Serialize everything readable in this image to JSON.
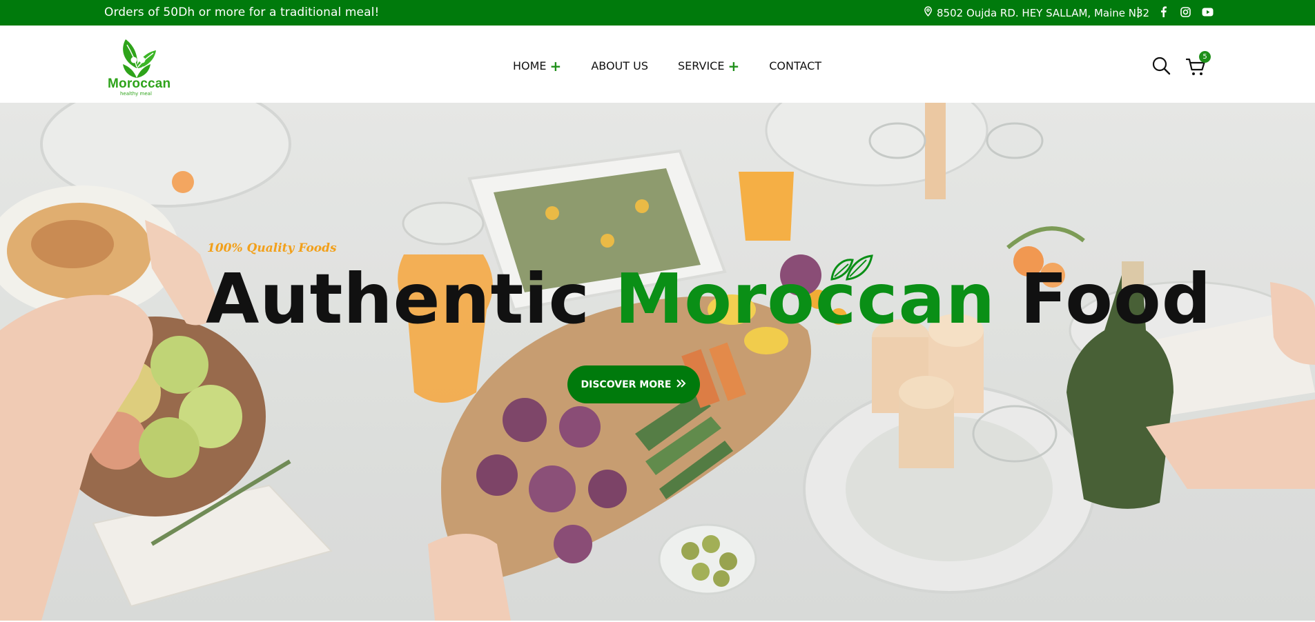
{
  "topbar": {
    "promo": "Orders of 50Dh or more for a traditional meal!",
    "address": "8502 Oujda RD. HEY SALLAM, Maine N32",
    "separator": "|",
    "social_icons": [
      "facebook-icon",
      "instagram-icon",
      "youtube-icon"
    ]
  },
  "header": {
    "logo": {
      "word": "Moroccan",
      "subtitle": "healthy meal"
    },
    "nav": [
      {
        "label": "HOME",
        "has_submenu": true
      },
      {
        "label": "ABOUT US",
        "has_submenu": false
      },
      {
        "label": "SERVICE",
        "has_submenu": true
      },
      {
        "label": "CONTACT",
        "has_submenu": false
      }
    ],
    "nav_plus": "+",
    "cart_count": "5"
  },
  "hero": {
    "tagline": "100% Quality Foods",
    "headline_part1": "Authentic ",
    "headline_part2": "Moroccan",
    "headline_part3": " Food",
    "cta_label": "DISCOVER MORE",
    "cta_icon": "double-chevron-right-icon"
  },
  "colors": {
    "brand_green": "#007a0c",
    "accent_green": "#0a8f16",
    "tagline_orange": "#f2a01a"
  }
}
